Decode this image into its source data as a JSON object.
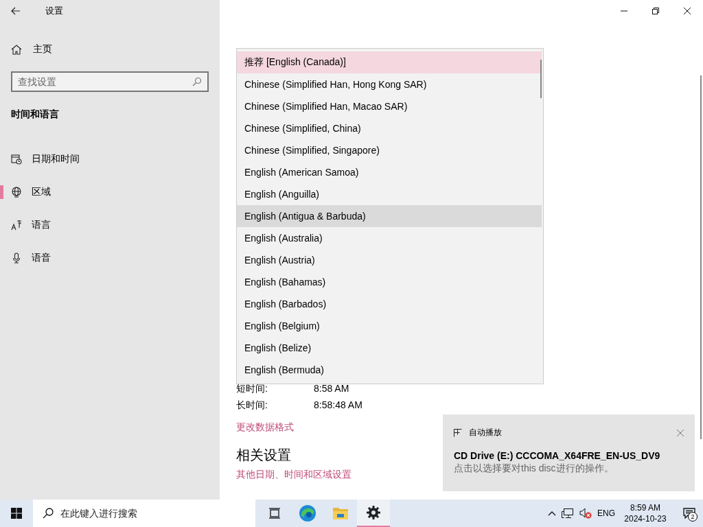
{
  "window": {
    "title": "设置"
  },
  "sidebar": {
    "home": "主页",
    "search": {
      "placeholder": "查找设置"
    },
    "section": "时间和语言",
    "items": [
      {
        "label": "日期和时间",
        "kind": "calendar",
        "selected": false
      },
      {
        "label": "区域",
        "kind": "globe",
        "selected": true
      },
      {
        "label": "语言",
        "kind": "language",
        "selected": false
      },
      {
        "label": "语音",
        "kind": "microphone",
        "selected": false
      }
    ]
  },
  "main": {
    "dropdown": {
      "options": [
        {
          "label": "推荐 [English (Canada)]",
          "selected": true,
          "hovered": false
        },
        {
          "label": "Chinese (Simplified Han, Hong Kong SAR)",
          "selected": false,
          "hovered": false
        },
        {
          "label": "Chinese (Simplified Han, Macao SAR)",
          "selected": false,
          "hovered": false
        },
        {
          "label": "Chinese (Simplified, China)",
          "selected": false,
          "hovered": false
        },
        {
          "label": "Chinese (Simplified, Singapore)",
          "selected": false,
          "hovered": false
        },
        {
          "label": "English (American Samoa)",
          "selected": false,
          "hovered": false
        },
        {
          "label": "English (Anguilla)",
          "selected": false,
          "hovered": false
        },
        {
          "label": "English (Antigua & Barbuda)",
          "selected": false,
          "hovered": true
        },
        {
          "label": "English (Australia)",
          "selected": false,
          "hovered": false
        },
        {
          "label": "English (Austria)",
          "selected": false,
          "hovered": false
        },
        {
          "label": "English (Bahamas)",
          "selected": false,
          "hovered": false
        },
        {
          "label": "English (Barbados)",
          "selected": false,
          "hovered": false
        },
        {
          "label": "English (Belgium)",
          "selected": false,
          "hovered": false
        },
        {
          "label": "English (Belize)",
          "selected": false,
          "hovered": false
        },
        {
          "label": "English (Bermuda)",
          "selected": false,
          "hovered": false
        }
      ]
    },
    "formats": [
      {
        "label": "短时间:",
        "value": "8:58 AM"
      },
      {
        "label": "长时间:",
        "value": "8:58:48 AM"
      }
    ],
    "format_link": "更改数据格式",
    "related": {
      "heading": "相关设置",
      "links": [
        "其他日期、时间和区域设置"
      ]
    }
  },
  "toast": {
    "app": "自动播放",
    "title": "CD Drive (E:) CCCOMA_X64FRE_EN-US_DV9",
    "body": "点击以选择要对this disc进行的操作。"
  },
  "taskbar": {
    "search": {
      "placeholder": "在此键入进行搜索"
    },
    "apps": [
      {
        "kind": "taskview",
        "selected": false
      },
      {
        "kind": "edge",
        "selected": false
      },
      {
        "kind": "explorer",
        "selected": false
      },
      {
        "kind": "settings",
        "selected": true
      }
    ],
    "tray": {
      "language": "ENG",
      "time": "8:59 AM",
      "date": "2024-10-23",
      "notifications": "2"
    }
  }
}
